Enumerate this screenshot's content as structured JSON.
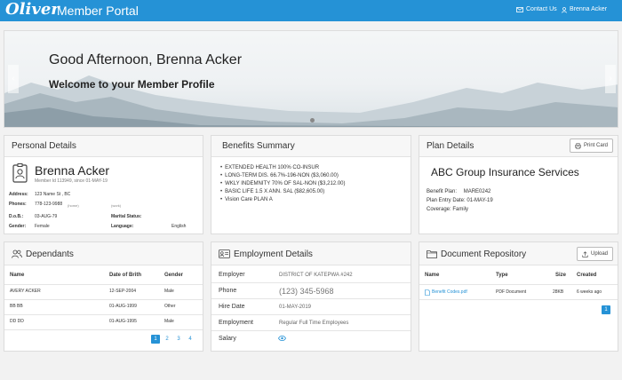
{
  "header": {
    "logo": "Oliver",
    "portal_title": "Member Portal",
    "contact_label": "Contact Us",
    "user_label": "Brenna Acker"
  },
  "hero": {
    "greeting": "Good Afternoon, Brenna Acker",
    "welcome": "Welcome to your Member Profile"
  },
  "personal": {
    "title": "Personal Details",
    "name": "Brenna Acker",
    "member_id": "Member Id 113949, since 01-MAY-19",
    "address_label": "Address:",
    "address": "123 Name St , BC",
    "phones_label": "Phones:",
    "phone_home": "778-123-9988",
    "phone_home_tag": "(home)",
    "phone_work_tag": "(work)",
    "dob_label": "D.o.B.:",
    "dob": "03-AUG-79",
    "marital_label": "Marital Status:",
    "marital": "",
    "gender_label": "Gender:",
    "gender": "Female",
    "language_label": "Language:",
    "language": "English"
  },
  "benefits": {
    "title": "Benefits Summary",
    "items": [
      "EXTENDED HEALTH 100% CO-INSUR",
      "LONG-TERM DIS. 66.7%-196-NON  ($3,060.00)",
      "WKLY INDEMNITY 70% OF SAL-NON  ($3,212.00)",
      "BASIC LIFE 1.5 X ANN. SAL  ($82,605.00)",
      "Vision Care PLAN A"
    ]
  },
  "plan": {
    "title": "Plan Details",
    "print_label": "Print Card",
    "plan_name": "ABC  Group Insurance Services",
    "benefit_plan_label": "Benefit Plan:",
    "benefit_plan": "MARE0242",
    "entry_date": "Plan Entry Date: 01-MAY-19",
    "coverage": "Coverage: Family"
  },
  "dependants": {
    "title": "Dependants",
    "headers": [
      "Name",
      "Date of Brith",
      "Gender"
    ],
    "rows": [
      [
        "AVERY ACKER",
        "12-SEP-2004",
        "Male"
      ],
      [
        "BB BB",
        "01-AUG-1999",
        "Other"
      ],
      [
        "DD DD",
        "01-AUG-1995",
        "Male"
      ]
    ],
    "pages": [
      "1",
      "2",
      "3",
      "4"
    ]
  },
  "employment": {
    "title": "Employment Details",
    "employer_label": "Employer",
    "employer": "DISTRICT OF KATEPWA #242",
    "phone_label": "Phone",
    "phone": "(123) 345-5968",
    "hire_label": "Hire Date",
    "hire": "01-MAY-2019",
    "employment_label": "Employment",
    "employment": "Regular Full Time Employees",
    "salary_label": "Salary"
  },
  "documents": {
    "title": "Document Repository",
    "upload_label": "Upload",
    "headers": [
      "Name",
      "Type",
      "Size",
      "Created"
    ],
    "rows": [
      [
        "Benefit Codes.pdf",
        "PDF Document",
        "28KB",
        "6 weeks ago"
      ]
    ],
    "pages": [
      "1"
    ]
  },
  "colors": {
    "brand": "#2592d6",
    "link": "#2592d6"
  },
  "icons": [
    "mail-icon",
    "user-icon",
    "id-badge-icon",
    "users-icon",
    "id-card-icon",
    "folder-icon",
    "printer-icon",
    "upload-icon",
    "eye-icon",
    "pdf-file-icon",
    "chevron-left-icon",
    "chevron-right-icon"
  ]
}
